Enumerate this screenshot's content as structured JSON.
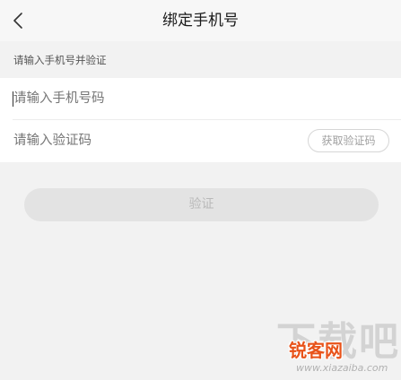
{
  "header": {
    "back_icon": "chevron-left-icon",
    "title": "绑定手机号"
  },
  "section": {
    "label": "请输入手机号并验证"
  },
  "form": {
    "phone_placeholder": "请输入手机号码",
    "phone_value": "",
    "code_placeholder": "请输入验证码",
    "code_value": "",
    "get_code_label": "获取验证码"
  },
  "verify_button": {
    "label": "验证"
  },
  "watermark": {
    "big_text": "下载吧",
    "logo_text": "锐客网",
    "url_text": "www.xiazaiba.com"
  },
  "colors": {
    "background": "#f2f2f2",
    "card": "#ffffff",
    "placeholder": "#a8a8a8",
    "disabled_button": "#e3e3e3",
    "logo_accent": "#e8531a"
  }
}
